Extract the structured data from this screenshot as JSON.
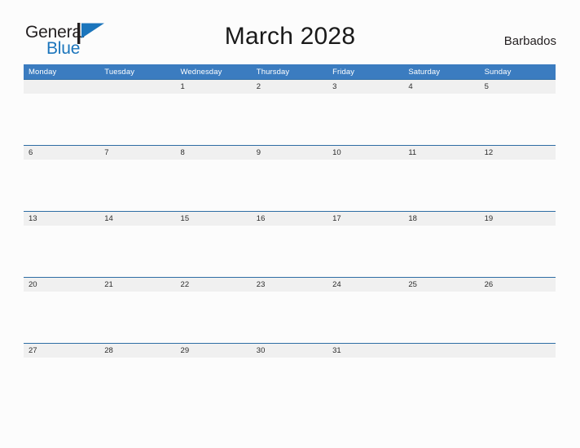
{
  "brand": {
    "name_part1": "General",
    "name_part2": "Blue",
    "mark": "triangle-flag-icon",
    "color_dark": "#231f20",
    "color_blue": "#1b75bc"
  },
  "header": {
    "title": "March 2028",
    "region": "Barbados"
  },
  "calendar": {
    "month": "March",
    "year": "2028",
    "week_start": "Monday",
    "header_color": "#3b7cc0",
    "divider_color": "#2e6da4",
    "date_band_color": "#f0f0f0",
    "weekdays": [
      "Monday",
      "Tuesday",
      "Wednesday",
      "Thursday",
      "Friday",
      "Saturday",
      "Sunday"
    ],
    "weeks": [
      [
        "",
        "",
        "1",
        "2",
        "3",
        "4",
        "5"
      ],
      [
        "6",
        "7",
        "8",
        "9",
        "10",
        "11",
        "12"
      ],
      [
        "13",
        "14",
        "15",
        "16",
        "17",
        "18",
        "19"
      ],
      [
        "20",
        "21",
        "22",
        "23",
        "24",
        "25",
        "26"
      ],
      [
        "27",
        "28",
        "29",
        "30",
        "31",
        "",
        ""
      ]
    ]
  }
}
